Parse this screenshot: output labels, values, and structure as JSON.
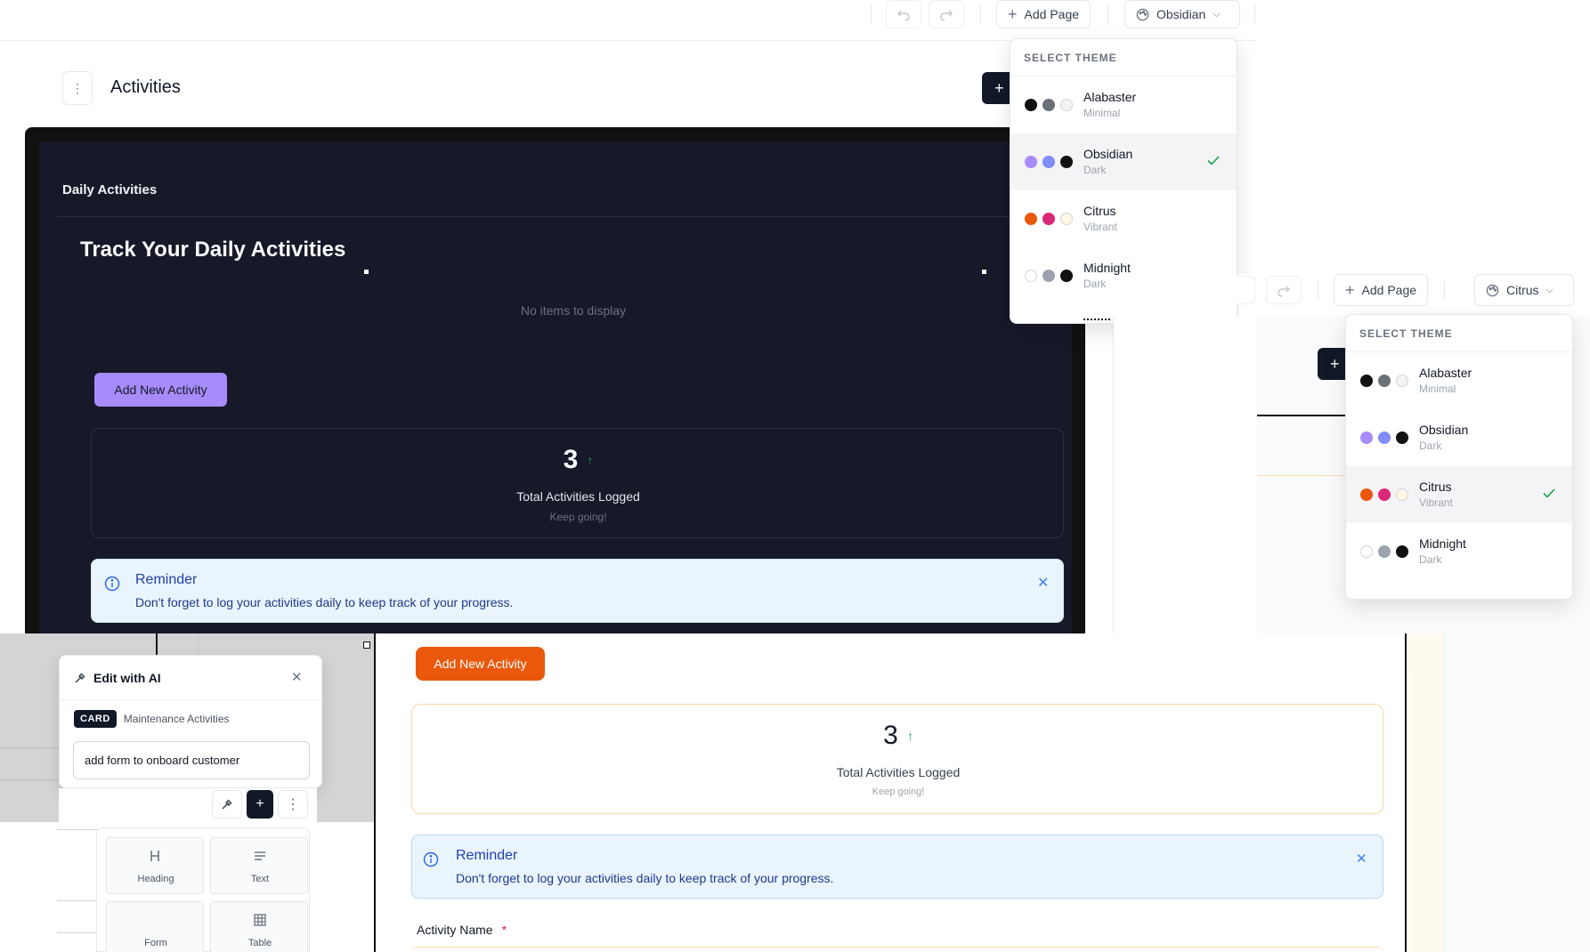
{
  "top_toolbar": {
    "add_page": "Add Page",
    "theme": "Obsidian"
  },
  "page": {
    "title": "Activities"
  },
  "theme_dropdown_1": {
    "header": "SELECT THEME",
    "items": [
      {
        "name": "Alabaster",
        "sub": "Minimal",
        "colors": [
          "#111111",
          "#6b6f76",
          "#f4f4f5"
        ],
        "selected": false
      },
      {
        "name": "Obsidian",
        "sub": "Dark",
        "colors": [
          "#a78bfa",
          "#818cf8",
          "#111111"
        ],
        "selected": true
      },
      {
        "name": "Citrus",
        "sub": "Vibrant",
        "colors": [
          "#ea580c",
          "#db2777",
          "#fff7e6"
        ],
        "selected": false
      },
      {
        "name": "Midnight",
        "sub": "Dark",
        "colors": [
          "#ffffff",
          "#9ca3af",
          "#111111"
        ],
        "selected": false
      }
    ]
  },
  "dark_panel": {
    "card_title": "Daily Activities",
    "heading": "Track Your Daily Activities",
    "empty": "No items to display",
    "add_button": "Add New Activity",
    "stat_value": "3",
    "stat_label": "Total Activities Logged",
    "stat_sub": "Keep going!",
    "reminder_title": "Reminder",
    "reminder_text": "Don't forget to log your activities daily to keep track of your progress."
  },
  "second_toolbar": {
    "add_page": "Add Page",
    "theme": "Citrus"
  },
  "theme_dropdown_2": {
    "header": "SELECT THEME",
    "items": [
      {
        "name": "Alabaster",
        "sub": "Minimal",
        "colors": [
          "#111111",
          "#6b6f76",
          "#f4f4f5"
        ],
        "selected": false
      },
      {
        "name": "Obsidian",
        "sub": "Dark",
        "colors": [
          "#a78bfa",
          "#818cf8",
          "#111111"
        ],
        "selected": false
      },
      {
        "name": "Citrus",
        "sub": "Vibrant",
        "colors": [
          "#ea580c",
          "#db2777",
          "#fff7e6"
        ],
        "selected": true
      },
      {
        "name": "Midnight",
        "sub": "Dark",
        "colors": [
          "#ffffff",
          "#9ca3af",
          "#111111"
        ],
        "selected": false
      }
    ]
  },
  "ai_panel": {
    "title": "Edit with AI",
    "tag": "CARD",
    "context": "Maintenance Activities",
    "input_value": "add form to onboard customer"
  },
  "blocks": [
    {
      "label": "Heading",
      "icon": "heading-icon"
    },
    {
      "label": "Text",
      "icon": "text-icon"
    },
    {
      "label": "Form",
      "icon": "form-icon"
    },
    {
      "label": "Table",
      "icon": "table-icon"
    }
  ],
  "light_panel": {
    "add_button": "Add New Activity",
    "stat_value": "3",
    "stat_label": "Total Activities Logged",
    "stat_sub": "Keep going!",
    "reminder_title": "Reminder",
    "reminder_text": "Don't forget to log your activities daily to keep track of your progress.",
    "field_label": "Activity Name",
    "required_mark": "*"
  },
  "colors": {
    "obsidian_accent": "#a78bfa",
    "citrus_accent": "#ea580c",
    "success": "#16a34a",
    "info": "#1d4ed8"
  }
}
